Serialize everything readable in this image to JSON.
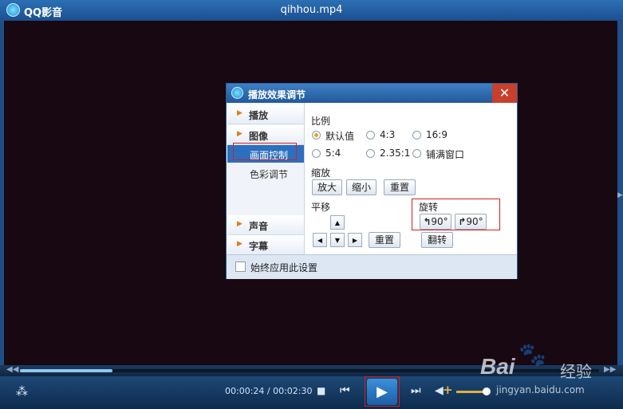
{
  "window": {
    "app_name": "QQ影音",
    "file_name": "qihhou.mp4"
  },
  "player": {
    "time_current": "00:00:24",
    "time_total": "00:02:30",
    "time_display": "00:00:24 / 00:02:30",
    "progress_fraction": 0.16,
    "volume_fraction": 0.9
  },
  "dialog": {
    "title": "播放效果调节",
    "close_label": "✕",
    "nav": {
      "play": "播放",
      "image": "图像",
      "image_sub": [
        "画面控制",
        "色彩调节"
      ],
      "sound": "声音",
      "subtitle": "字幕"
    },
    "ratio": {
      "label": "比例",
      "options": [
        "默认值",
        "4:3",
        "16:9",
        "5:4",
        "2.35:1",
        "铺满窗口"
      ],
      "selected": "默认值"
    },
    "zoom": {
      "label": "缩放",
      "zoom_in": "放大",
      "zoom_out": "缩小",
      "reset": "重置"
    },
    "pan": {
      "label": "平移",
      "reset": "重置"
    },
    "rotate": {
      "label": "旋转",
      "left": "90°",
      "right": "90°",
      "flip": "翻转"
    },
    "footer": {
      "always_apply": "始终应用此设置"
    }
  },
  "watermark": {
    "logo": "Bai",
    "logo2": "经验",
    "url": "jingyan.baidu.com"
  },
  "icons": [
    "app-logo-icon",
    "close-icon",
    "stop-icon",
    "prev-icon",
    "play-icon",
    "next-icon",
    "volume-icon",
    "footprint-icon",
    "arrow-up-icon",
    "arrow-down-icon",
    "arrow-left-icon",
    "arrow-right-icon",
    "rotate-left-icon",
    "rotate-right-icon"
  ]
}
